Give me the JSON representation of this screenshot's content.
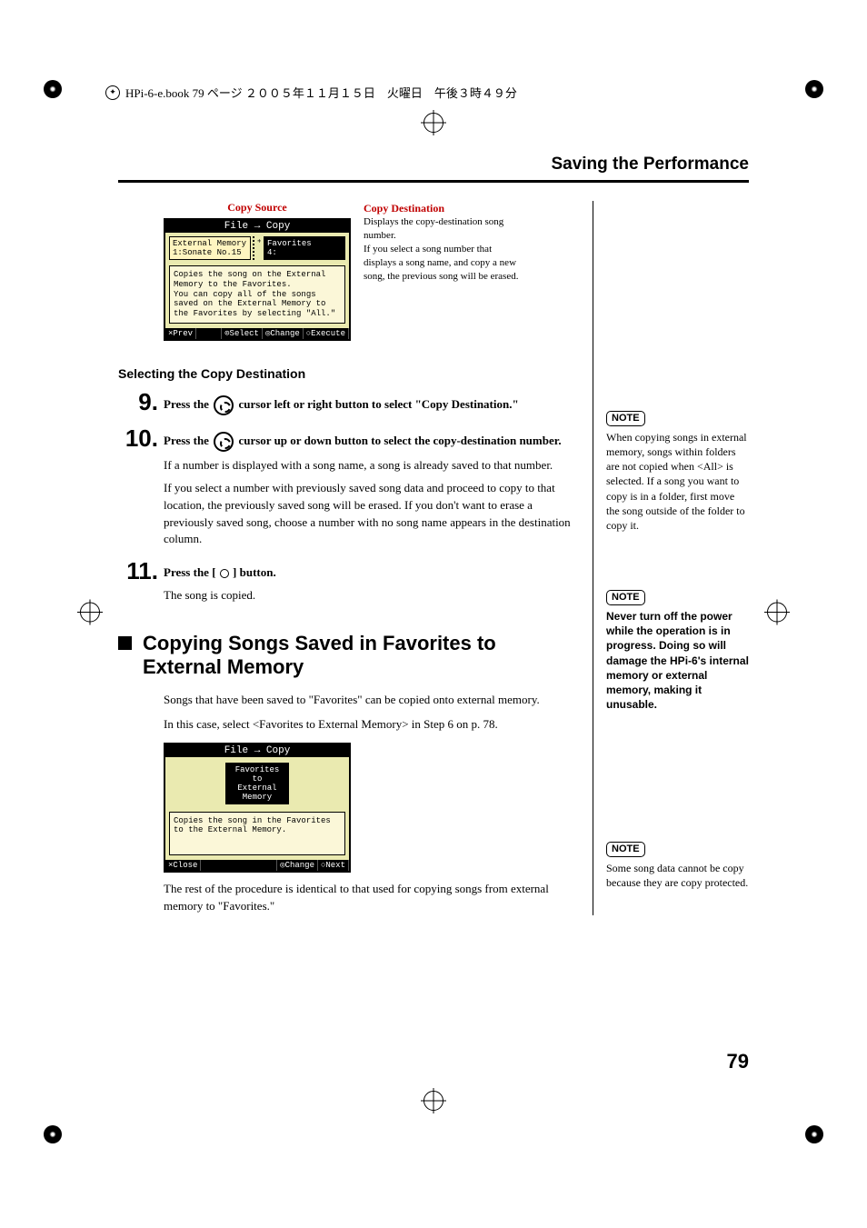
{
  "header_text": "HPi-6-e.book 79 ページ ２００５年１１月１５日　火曜日　午後３時４９分",
  "running_head": "Saving the Performance",
  "fig1": {
    "copy_source_label": "Copy Source",
    "copy_dest_label": "Copy Destination",
    "copy_dest_body": "Displays the copy-destination song number.\nIf you select a song number that displays a song name, and copy a new song, the previous song will be erased.",
    "lcd_title": "File → Copy",
    "lcd_left_line1": "External Memory",
    "lcd_left_line2": "1:Sonate No.15",
    "lcd_right_line1": "Favorites",
    "lcd_right_line2": "4:",
    "lcd_desc": "Copies the song on the External Memory to the Favorites.\nYou can copy all of the songs saved on the External Memory to the Favorites by selecting \"All.\"",
    "lcd_foot_prev": "×Prev",
    "lcd_foot_select": "⊙Select",
    "lcd_foot_change": "◎Change",
    "lcd_foot_execute": "○Execute"
  },
  "subhead": "Selecting the Copy Destination",
  "steps": {
    "s9": {
      "num": "9",
      "lead_a": "Press the ",
      "lead_b": " cursor left or right button to select \"Copy Destination.\""
    },
    "s10": {
      "num": "10",
      "lead_a": "Press the ",
      "lead_b": " cursor up or down button to select the copy-destination number.",
      "p1": "If a number is displayed with a song name, a song is already saved to that number.",
      "p2": "If you select a number with previously saved song data and proceed to copy to that location, the previously saved song will be erased. If you don't want to erase a previously saved song, choose a number with no song name appears in the destination column."
    },
    "s11": {
      "num": "11",
      "lead_a": "Press the [ ",
      "lead_b": " ] button.",
      "p1": "The song is copied."
    }
  },
  "h2": "Copying Songs Saved in Favorites to External Memory",
  "body1": "Songs that have been saved to \"Favorites\" can be copied onto external memory.",
  "body2": "In this case, select <Favorites to External Memory> in Step 6 on p. 78.",
  "fig2": {
    "lcd_title": "File → Copy",
    "lcd_box": "Favorites\nto\nExternal\nMemory",
    "lcd_desc": "Copies the song in the Favorites to the External Memory.",
    "lcd_foot_close": "×Close",
    "lcd_foot_change": "◎Change",
    "lcd_foot_next": "○Next"
  },
  "body3": "The rest of the procedure is identical to that used for copying songs from external memory to \"Favorites.\"",
  "side": {
    "note_label": "NOTE",
    "note1": "When copying songs in external memory, songs within folders are not copied when <All> is selected. If a song you want to copy is in a folder, first move the song outside of the folder to copy it.",
    "note2": "Never turn off the power while the operation is in progress. Doing so will damage the HPi-6's internal memory or external memory, making it unusable.",
    "note3": "Some song data cannot be copy because they are copy protected."
  },
  "page_num": "79"
}
